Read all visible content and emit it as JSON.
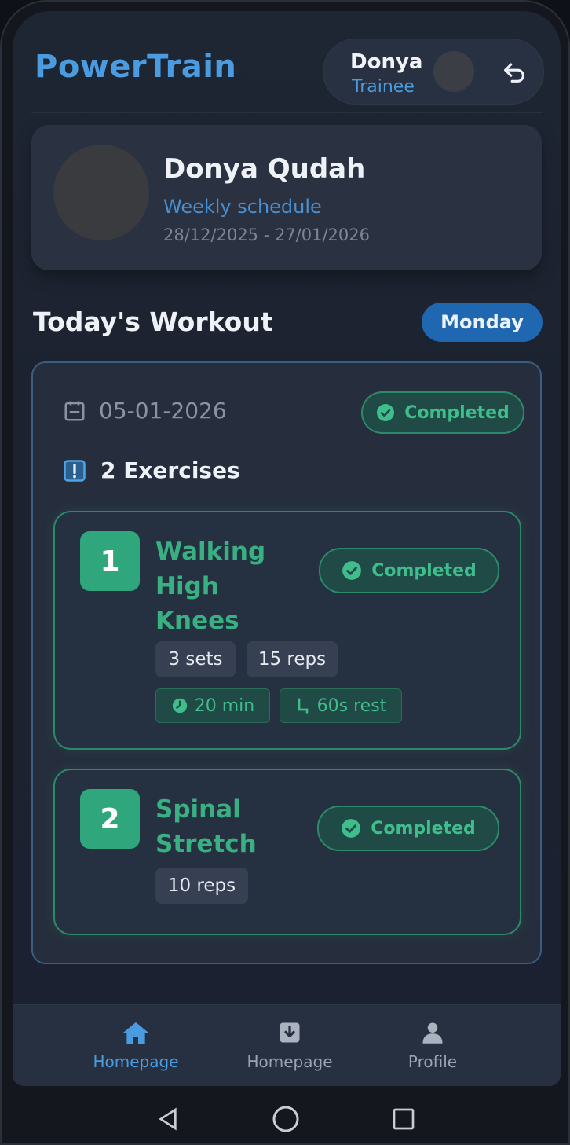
{
  "header": {
    "app_title": "PowerTrain",
    "user_name": "Donya",
    "user_role": "Trainee",
    "back_icon": "undo-arrow-icon"
  },
  "profile": {
    "name": "Donya Qudah",
    "subtitle": "Weekly schedule",
    "date_range": "28/12/2025 - 27/01/2026"
  },
  "workout": {
    "section_title": "Today's Workout",
    "day": "Monday",
    "date": "05-01-2026",
    "status": "Completed",
    "exercise_count_label": "2 Exercises",
    "exercises": [
      {
        "number": "1",
        "name": "Walking High Knees",
        "status": "Completed",
        "sets": "3 sets",
        "reps": "15 reps",
        "duration": "20 min",
        "rest": "60s rest"
      },
      {
        "number": "2",
        "name": "Spinal Stretch",
        "status": "Completed",
        "reps": "10 reps"
      }
    ]
  },
  "nav": {
    "items": [
      {
        "label": "Homepage",
        "icon": "home-icon",
        "active": true
      },
      {
        "label": "Homepage",
        "icon": "download-box-icon",
        "active": false
      },
      {
        "label": "Profile",
        "icon": "person-icon",
        "active": false
      }
    ]
  },
  "colors": {
    "accent": "#4a9be0",
    "success": "#2fa67c",
    "background": "#1f2633"
  }
}
